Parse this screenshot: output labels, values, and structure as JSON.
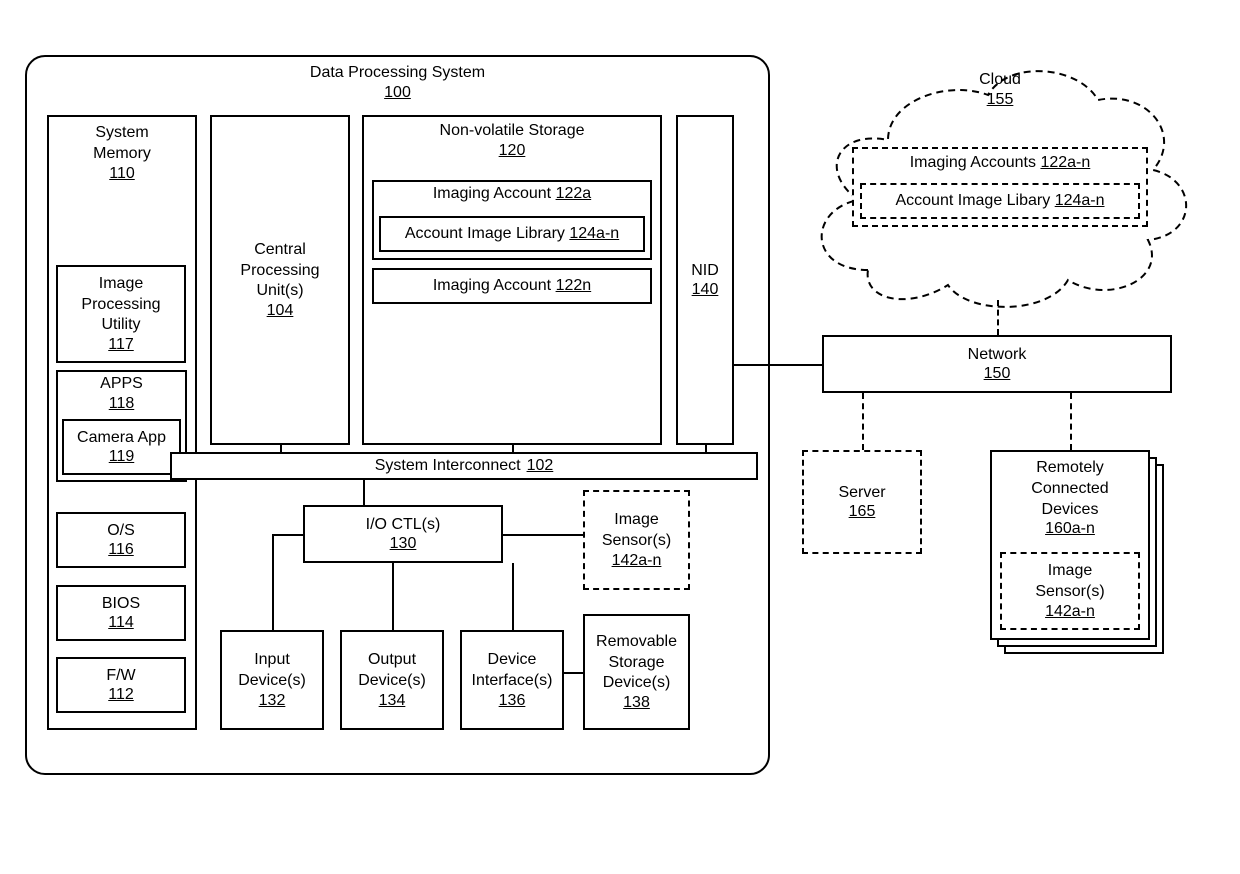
{
  "dps": {
    "title": "Data Processing System",
    "num": "100"
  },
  "sysmem": {
    "title": "System Memory",
    "num": "110"
  },
  "ipu": {
    "title": "Image Processing Utility",
    "num": "117"
  },
  "apps": {
    "title": "APPS",
    "num": "118"
  },
  "cam": {
    "title": "Camera App",
    "num": "119"
  },
  "os": {
    "title": "O/S",
    "num": "116"
  },
  "bios": {
    "title": "BIOS",
    "num": "114"
  },
  "fw": {
    "title": "F/W",
    "num": "112"
  },
  "cpu": {
    "title": "Central Processing Unit(s)",
    "num": "104"
  },
  "nvs": {
    "title": "Non-volatile Storage",
    "num": "120"
  },
  "imgacct1": {
    "title": "Imaging Account",
    "num": "122a"
  },
  "ail": {
    "title": "Account Image Library",
    "num": "124a-n"
  },
  "imgacctn": {
    "title": "Imaging Account",
    "num": "122n"
  },
  "nid": {
    "title": "NID",
    "num": "140"
  },
  "sysint": {
    "title": "System Interconnect",
    "num": "102"
  },
  "ioctl": {
    "title": "I/O CTL(s)",
    "num": "130"
  },
  "imgsens": {
    "title": "Image Sensor(s)",
    "num": "142a-n"
  },
  "input": {
    "title": "Input Device(s)",
    "num": "132"
  },
  "output": {
    "title": "Output Device(s)",
    "num": "134"
  },
  "devint": {
    "title": "Device Interface(s)",
    "num": "136"
  },
  "remstor": {
    "title": "Removable Storage Device(s)",
    "num": "138"
  },
  "cloud": {
    "title": "Cloud",
    "num": "155"
  },
  "cloudacct": {
    "title": "Imaging Accounts",
    "num": "122a-n"
  },
  "cloudlib": {
    "title": "Account Image Libary",
    "num": "124a-n"
  },
  "network": {
    "title": "Network",
    "num": "150"
  },
  "server": {
    "title": "Server",
    "num": "165"
  },
  "rcd": {
    "title": "Remotely Connected Devices",
    "num": "160a-n"
  },
  "rcdsens": {
    "title": "Image Sensor(s)",
    "num": "142a-n"
  }
}
